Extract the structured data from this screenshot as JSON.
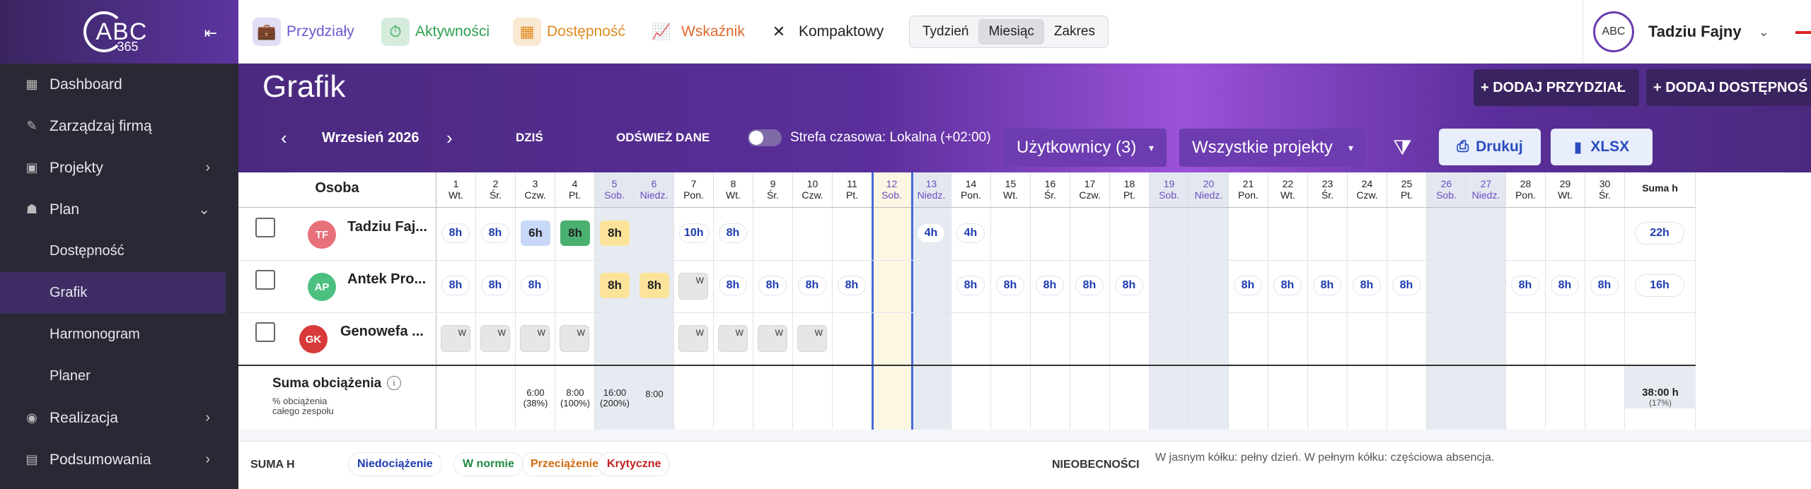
{
  "sidebar": {
    "items": [
      {
        "label": "Dashboard",
        "icon": "dashboard-icon",
        "glyph": "▦",
        "chev": ""
      },
      {
        "label": "Zarządzaj firmą",
        "icon": "edit-icon",
        "glyph": "✎",
        "chev": ""
      },
      {
        "label": "Projekty",
        "icon": "projects-icon",
        "glyph": "▣",
        "chev": "›"
      },
      {
        "label": "Plan",
        "icon": "people-icon",
        "glyph": "☗",
        "chev": "⌄"
      },
      {
        "label": "Dostępność",
        "sub": true
      },
      {
        "label": "Grafik",
        "sub": true,
        "active": true
      },
      {
        "label": "Harmonogram",
        "sub": true
      },
      {
        "label": "Planer",
        "sub": true
      },
      {
        "label": "Realizacja",
        "icon": "coins-icon",
        "glyph": "◉",
        "chev": "›"
      },
      {
        "label": "Podsumowania",
        "icon": "report-icon",
        "glyph": "▤",
        "chev": "›"
      }
    ],
    "logo_text": "ABC",
    "logo_num": "365"
  },
  "topbar": {
    "tabs": [
      {
        "label": "Przydziały",
        "color": "#6a5ad0",
        "icon": "briefcase-icon",
        "glyph": "💼"
      },
      {
        "label": "Aktywności",
        "color": "#2ea050",
        "icon": "stopwatch-icon",
        "glyph": "⏱"
      },
      {
        "label": "Dostępność",
        "color": "#e08a20",
        "icon": "calendar-icon",
        "glyph": "▦"
      },
      {
        "label": "Wskaźnik",
        "color": "#e0682a",
        "icon": "chart-icon",
        "glyph": "📈"
      },
      {
        "label": "Kompaktowy",
        "color": "#222",
        "icon": "compress-icon",
        "glyph": "✕"
      }
    ],
    "views": [
      "Tydzień",
      "Miesiąc",
      "Zakres"
    ],
    "selected_view": "Miesiąc",
    "user_logo": "ABC",
    "user_name": "Tadziu Fajny"
  },
  "header": {
    "title": "Grafik",
    "add_assignment": "+ DODAJ PRZYDZIAŁ",
    "add_availability": "+ DODAJ DOSTĘPNOŚ",
    "month": "Wrzesień 2026",
    "today": "DZIŚ",
    "refresh": "ODŚWIEŻ DANE",
    "timezone": "Strefa czasowa: Lokalna (+02:00)",
    "users_filter": "Użytkownicy (3)",
    "projects_filter": "Wszystkie projekty",
    "print": "Drukuj",
    "xlsx": "XLSX"
  },
  "grid": {
    "person_header": "Osoba",
    "sum_header": "Suma h",
    "days": [
      {
        "n": "1",
        "d": "Wt."
      },
      {
        "n": "2",
        "d": "Śr."
      },
      {
        "n": "3",
        "d": "Czw."
      },
      {
        "n": "4",
        "d": "Pt."
      },
      {
        "n": "5",
        "d": "Sob.",
        "we": true
      },
      {
        "n": "6",
        "d": "Niedz.",
        "we": true
      },
      {
        "n": "7",
        "d": "Pon."
      },
      {
        "n": "8",
        "d": "Wt."
      },
      {
        "n": "9",
        "d": "Śr."
      },
      {
        "n": "10",
        "d": "Czw."
      },
      {
        "n": "11",
        "d": "Pt."
      },
      {
        "n": "12",
        "d": "Sob.",
        "today": true
      },
      {
        "n": "13",
        "d": "Niedz.",
        "we": true
      },
      {
        "n": "14",
        "d": "Pon."
      },
      {
        "n": "15",
        "d": "Wt."
      },
      {
        "n": "16",
        "d": "Śr."
      },
      {
        "n": "17",
        "d": "Czw."
      },
      {
        "n": "18",
        "d": "Pt."
      },
      {
        "n": "19",
        "d": "Sob.",
        "we": true
      },
      {
        "n": "20",
        "d": "Niedz.",
        "we": true
      },
      {
        "n": "21",
        "d": "Pon."
      },
      {
        "n": "22",
        "d": "Wt."
      },
      {
        "n": "23",
        "d": "Śr."
      },
      {
        "n": "24",
        "d": "Czw."
      },
      {
        "n": "25",
        "d": "Pt."
      },
      {
        "n": "26",
        "d": "Sob.",
        "we": true
      },
      {
        "n": "27",
        "d": "Niedz.",
        "we": true
      },
      {
        "n": "28",
        "d": "Pon."
      },
      {
        "n": "29",
        "d": "Wt."
      },
      {
        "n": "30",
        "d": "Śr."
      }
    ],
    "people": [
      {
        "initials": "TF",
        "name": "Tadziu Faj...",
        "color": "#e8707a",
        "sum": "22h",
        "cells": {
          "1": "8h",
          "2": "8h",
          "3": "6h",
          "4": "8h",
          "5": "8h",
          "7": "10h",
          "8": "8h",
          "13": "4h",
          "14": "4h"
        }
      },
      {
        "initials": "AP",
        "name": "Antek Pro...",
        "color": "#4cc080",
        "sum": "16h",
        "cells": {
          "1": "8h",
          "2": "8h",
          "3": "8h",
          "5": "8h",
          "6": "8h",
          "7": "W",
          "8": "8h",
          "9": "8h",
          "10": "8h",
          "11": "8h",
          "14": "8h",
          "15": "8h",
          "16": "8h",
          "17": "8h",
          "18": "8h",
          "21": "8h",
          "22": "8h",
          "23": "8h",
          "24": "8h",
          "25": "8h",
          "28": "8h",
          "29": "8h",
          "30": "8h"
        }
      },
      {
        "initials": "GK",
        "name": "Genowefa ...",
        "color": "#d83a3a",
        "sum": "",
        "cells": {
          "1": "W",
          "2": "W",
          "3": "W",
          "4": "W",
          "7": "W",
          "8": "W",
          "9": "W",
          "10": "W"
        }
      }
    ],
    "summary_title": "Suma obciążenia",
    "summary_sub1": "% obciążenia",
    "summary_sub2": "całego zespołu",
    "summary_cells": {
      "3": [
        "6:00",
        "(38%)"
      ],
      "4": [
        "8:00",
        "(100%)"
      ],
      "5": [
        "16:00",
        "(200%)"
      ],
      "6": [
        "8:00",
        ""
      ]
    },
    "summary_total": "38:00 h",
    "summary_total_pct": "(17%)"
  },
  "legend": {
    "title": "SUMA H",
    "items": [
      {
        "label": "Niedociążenie",
        "color": "#1e3cb0"
      },
      {
        "label": "W normie",
        "color": "#1e8a40"
      },
      {
        "label": "Przeciążenie",
        "color": "#d06a10"
      },
      {
        "label": "Krytyczne",
        "color": "#c02020"
      }
    ],
    "absence_title": "NIEOBECNOŚCI",
    "absence_text": "W jasnym kółku: pełny dzień. W pełnym kółku: częściowa absencja."
  }
}
